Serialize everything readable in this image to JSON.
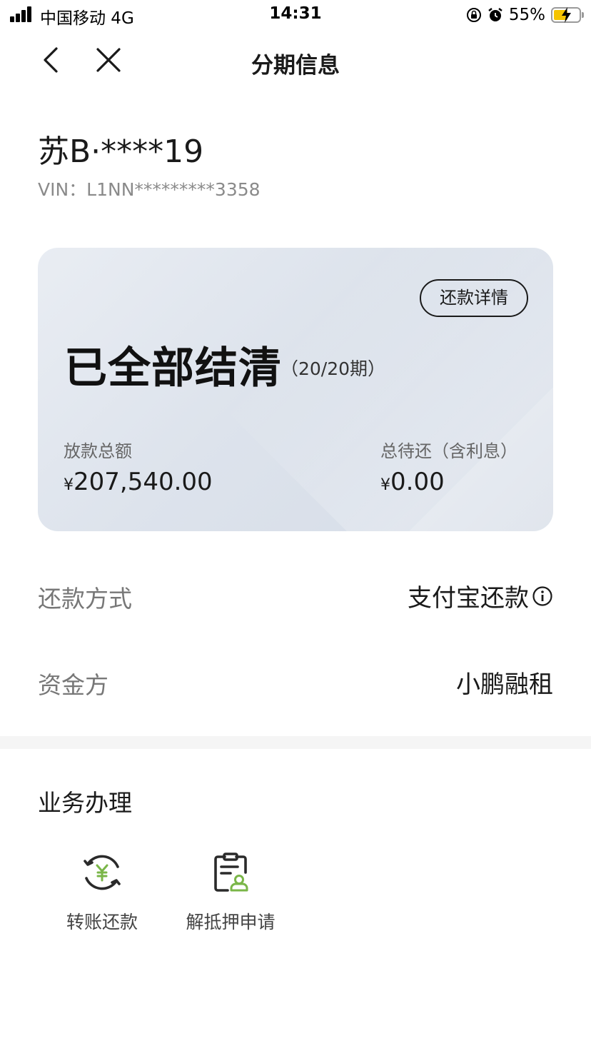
{
  "status_bar": {
    "carrier": "中国移动  4G",
    "time": "14:31",
    "battery_percent": "55%",
    "battery_level": 0.55,
    "battery_color": "#f5c400"
  },
  "nav": {
    "title": "分期信息",
    "back_icon": "chevron-left-icon",
    "close_icon": "close-icon"
  },
  "vehicle": {
    "plate": "苏B·****19",
    "vin": "VIN：L1NN*********3358"
  },
  "card": {
    "detail_button": "还款详情",
    "status": "已全部结清",
    "periods": "（20/20期）",
    "loan_total_label": "放款总额",
    "loan_total_currency": "¥",
    "loan_total_value": "207,540.00",
    "remaining_label": "总待还（含利息）",
    "remaining_currency": "¥",
    "remaining_value": "0.00"
  },
  "info": {
    "repay_method_label": "还款方式",
    "repay_method_value": "支付宝还款",
    "funder_label": "资金方",
    "funder_value": "小鹏融租"
  },
  "services": {
    "title": "业务办理",
    "items": [
      {
        "label": "转账还款",
        "icon": "yen-refresh-icon"
      },
      {
        "label": "解抵押申请",
        "icon": "clipboard-user-icon"
      }
    ],
    "accent_color": "#7ab648"
  }
}
